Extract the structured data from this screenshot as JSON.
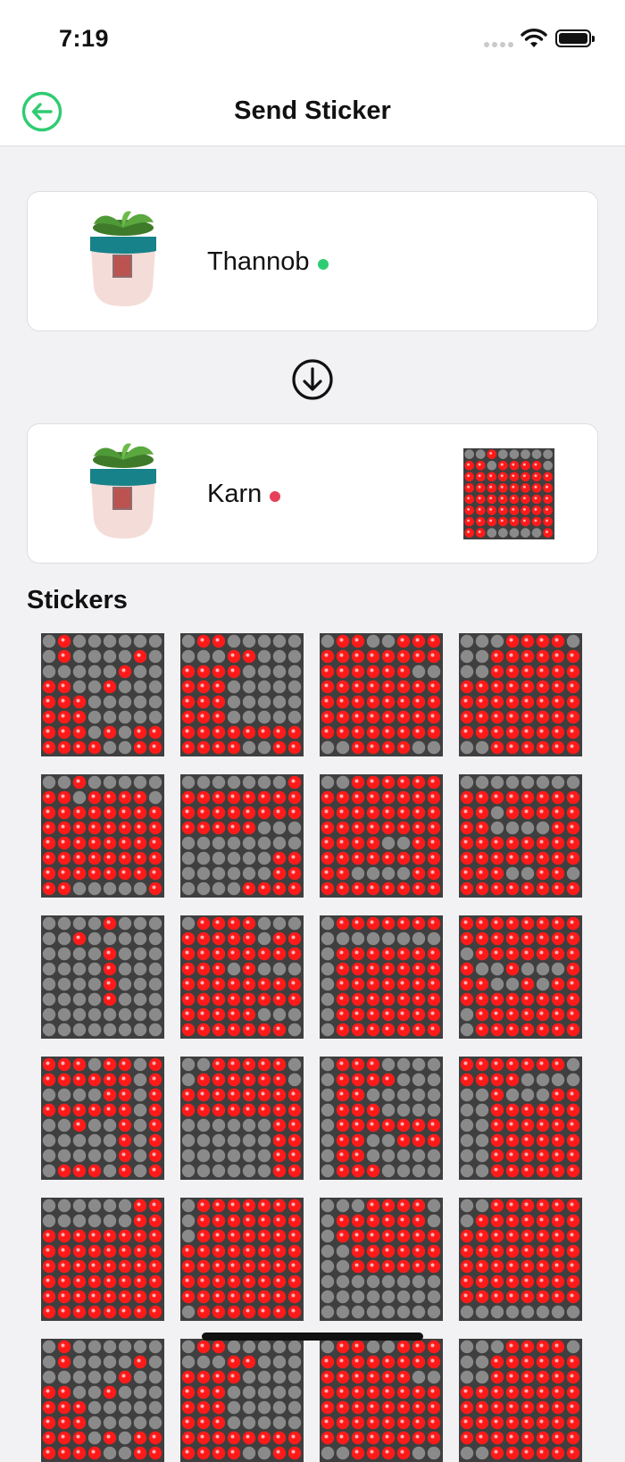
{
  "status_bar": {
    "time": "7:19"
  },
  "header": {
    "title": "Send Sticker"
  },
  "sender": {
    "name": "Thannob",
    "status": "online",
    "status_color": "#2ecc71"
  },
  "receiver": {
    "name": "Karn",
    "status": "offline",
    "status_color": "#e8405a",
    "preview_sticker": 4
  },
  "stickers_section": {
    "title": "Stickers"
  },
  "colors": {
    "accent": "#2ecc71",
    "led_on": "#ff1a1a",
    "led_off": "#8a8a8a",
    "matrix_bg": "#3f3f3f"
  },
  "stickers": [
    [
      "01000000",
      "01000010",
      "00000100",
      "11001000",
      "11100000",
      "11100000",
      "11101011",
      "11110011"
    ],
    [
      "01100000",
      "00011000",
      "11110000",
      "11100000",
      "11100000",
      "11100000",
      "11111111",
      "11110011"
    ],
    [
      "01100111",
      "11111111",
      "11111100",
      "11111111",
      "11111111",
      "11111111",
      "11111111",
      "00111100"
    ],
    [
      "00011110",
      "00111111",
      "00111111",
      "11111111",
      "11111111",
      "11111111",
      "11111111",
      "00111111"
    ],
    [
      "00100000",
      "11011110",
      "11111111",
      "11111111",
      "11111111",
      "11111111",
      "11111111",
      "11000001"
    ],
    [
      "00000001",
      "11111111",
      "11111111",
      "11111000",
      "00000000",
      "00000011",
      "00000011",
      "00001111"
    ],
    [
      "00111111",
      "11111111",
      "11111111",
      "11111111",
      "11110011",
      "11111111",
      "11000011",
      "11111111"
    ],
    [
      "00000000",
      "11111111",
      "11011111",
      "11000011",
      "11111111",
      "11111111",
      "11100110",
      "11111111"
    ],
    [
      "00001000",
      "00100000",
      "00001000",
      "00001000",
      "00001000",
      "00001000",
      "00000000",
      "00000000"
    ],
    [
      "01111000",
      "11111011",
      "11111111",
      "11101000",
      "11111111",
      "11111111",
      "11111000",
      "11111110"
    ],
    [
      "01111111",
      "00000000",
      "01111111",
      "01111111",
      "01111111",
      "01111111",
      "01111111",
      "01111111"
    ],
    [
      "11111111",
      "11111111",
      "01111111",
      "10010001",
      "11001011",
      "11111111",
      "01111111",
      "01111111"
    ],
    [
      "11101101",
      "11111101",
      "00001101",
      "11111101",
      "00100101",
      "00000101",
      "00000101",
      "01110101"
    ],
    [
      "00111110",
      "01111110",
      "11111111",
      "11111111",
      "00000011",
      "00000011",
      "00000011",
      "00000011"
    ],
    [
      "01110000",
      "01111000",
      "01100000",
      "01110000",
      "01111111",
      "01100111",
      "01100000",
      "01110000"
    ],
    [
      "11111110",
      "11110000",
      "00100011",
      "00111111",
      "00111111",
      "00111111",
      "00111111",
      "00111111"
    ],
    [
      "00000011",
      "00000011",
      "11111111",
      "11111111",
      "11111111",
      "11111111",
      "11111111",
      "11111111"
    ],
    [
      "01111111",
      "01111111",
      "01111111",
      "11111111",
      "11111111",
      "11111111",
      "11111111",
      "01111111"
    ],
    [
      "00011110",
      "01111110",
      "01111111",
      "00111111",
      "00111111",
      "00000000",
      "00000000",
      "00000000"
    ],
    [
      "00111111",
      "01111111",
      "11111111",
      "11111111",
      "11111111",
      "11111111",
      "11111111",
      "00000000"
    ]
  ]
}
